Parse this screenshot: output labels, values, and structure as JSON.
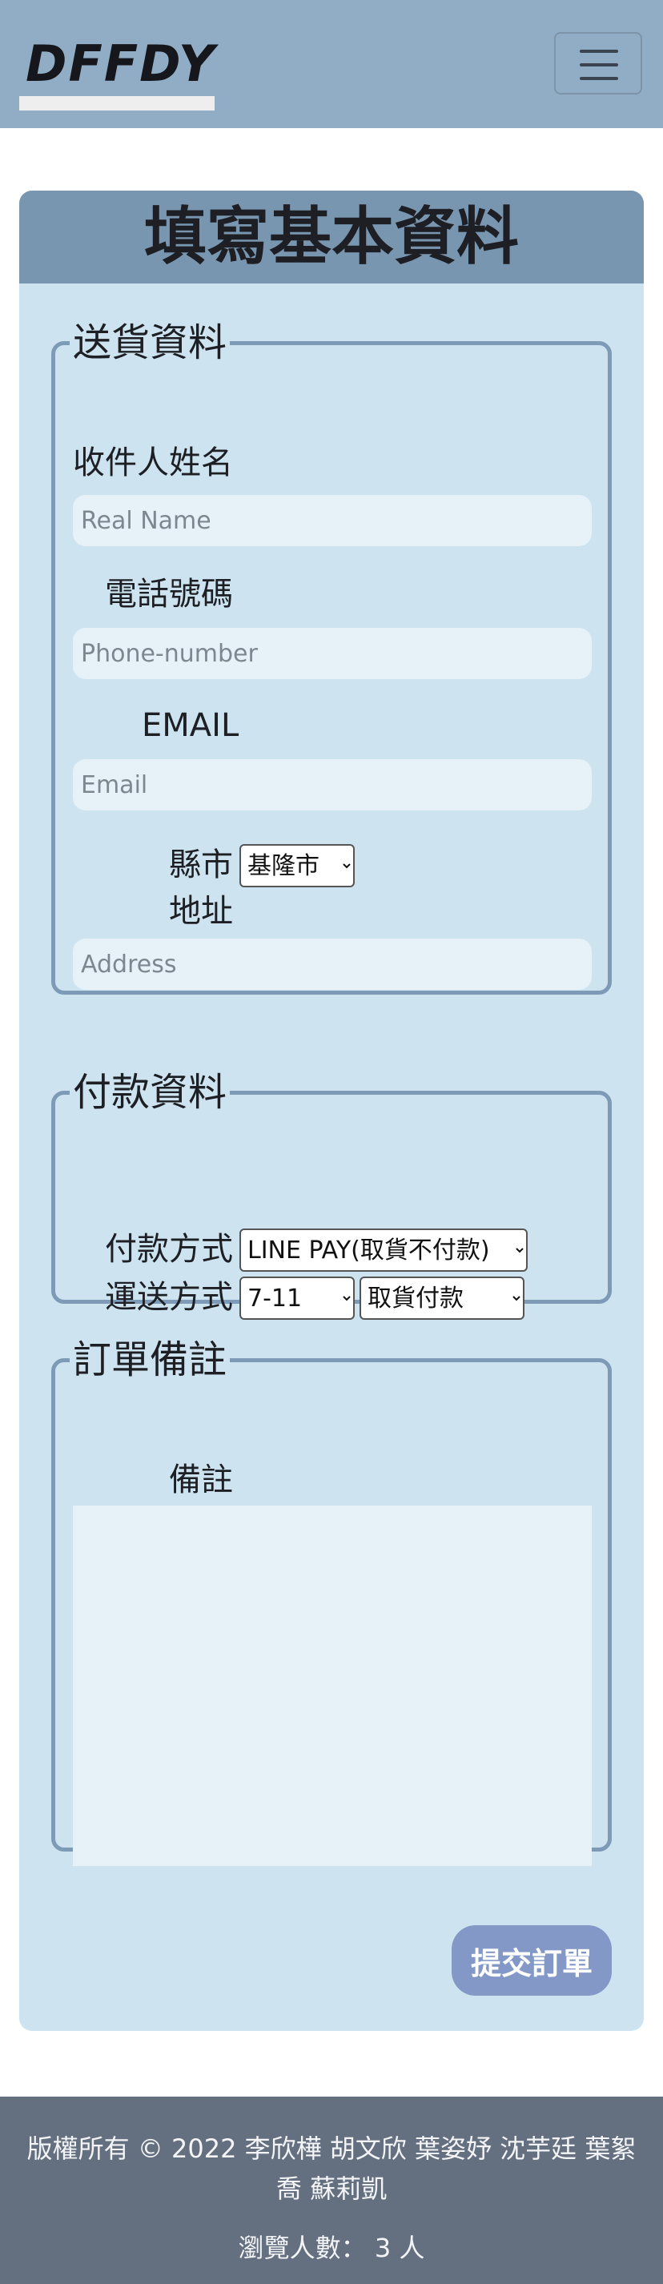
{
  "navbar": {
    "brand": "DFFDY",
    "menu_icon": "hamburger-menu-icon"
  },
  "form": {
    "title": "填寫基本資料",
    "shipping": {
      "legend": "送貨資料",
      "name_label": "收件人姓名",
      "name_placeholder": "Real Name",
      "phone_label": "電話號碼",
      "phone_placeholder": "Phone-number",
      "email_label": "EMAIL",
      "email_placeholder": "Email",
      "city_label": "縣市",
      "city_selected": "基隆市",
      "address_label": "地址",
      "address_placeholder": "Address"
    },
    "payment": {
      "legend": "付款資料",
      "method_label": "付款方式",
      "method_selected": "LINE PAY(取貨不付款)",
      "shipping_label": "運送方式",
      "shipping_selected": "7-11",
      "shipping_pay_selected": "取貨付款"
    },
    "notes": {
      "legend": "訂單備註",
      "label": "備註",
      "value": ""
    },
    "submit_label": "提交訂單"
  },
  "footer": {
    "copyright": "版權所有 © 2022 李欣樺 胡文欣 葉姿妤 沈芋廷 葉絮喬 蘇莉凱",
    "views": "瀏覽人數： 3 人"
  },
  "colors": {
    "navbar": "#91adc6",
    "card": "#cde4f0",
    "card_header": "#7996b1",
    "submit": "#8398c6",
    "footer": "#646f80"
  }
}
